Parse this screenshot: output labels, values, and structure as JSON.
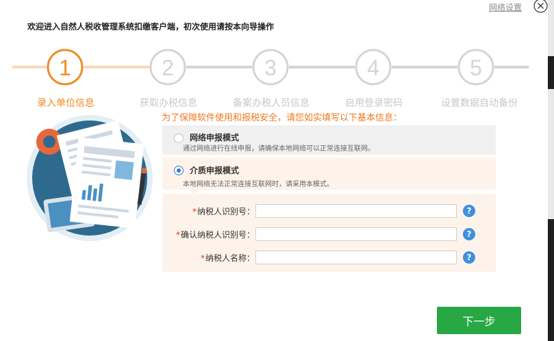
{
  "header": {
    "network_link": "网络设置",
    "welcome": "欢迎进入自然人税收管理系统扣缴客户端，初次使用请按本向导操作"
  },
  "steps": [
    {
      "number": "1",
      "label": "录入单位信息",
      "active": true
    },
    {
      "number": "2",
      "label": "获取办税信息",
      "active": false
    },
    {
      "number": "3",
      "label": "备案办税人员信息",
      "active": false
    },
    {
      "number": "4",
      "label": "启用登录密码",
      "active": false
    },
    {
      "number": "5",
      "label": "设置数据自动备份",
      "active": false
    }
  ],
  "hint": "为了保障软件使用和报税安全，请您如实填写以下基本信息：",
  "modes": {
    "online": {
      "title": "网络申报模式",
      "desc": "通过网络进行在线申报，请确保本地网络可以正常连接互联网。",
      "selected": false
    },
    "media": {
      "title": "介质申报模式",
      "desc": "本地网络无法正常连接互联网时，请采用本模式。",
      "selected": true
    }
  },
  "form": {
    "required_mark": "*",
    "fields": [
      {
        "label": "纳税人识别号：",
        "value": "",
        "help": "?"
      },
      {
        "label": "确认纳税人识别号：",
        "value": "",
        "help": "?"
      },
      {
        "label": "纳税人名称：",
        "value": "",
        "help": "?"
      }
    ]
  },
  "buttons": {
    "next": "下一步"
  },
  "colors": {
    "accent_orange": "#f08a24",
    "inactive_gray": "#cfcfcf",
    "primary_green": "#28a745",
    "help_blue": "#3f8fe0"
  }
}
